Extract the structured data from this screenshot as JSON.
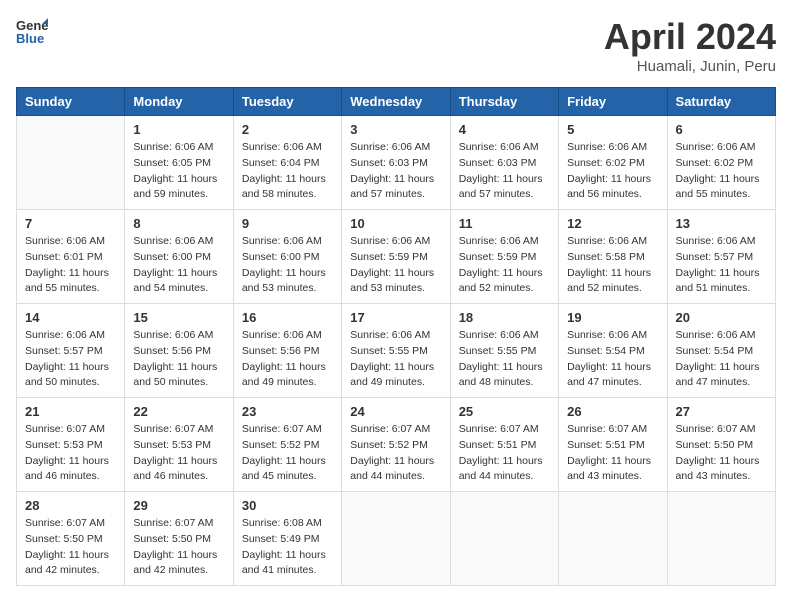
{
  "header": {
    "logo_line1": "General",
    "logo_line2": "Blue",
    "title": "April 2024",
    "subtitle": "Huamali, Junin, Peru"
  },
  "weekdays": [
    "Sunday",
    "Monday",
    "Tuesday",
    "Wednesday",
    "Thursday",
    "Friday",
    "Saturday"
  ],
  "weeks": [
    [
      {
        "day": "",
        "info": ""
      },
      {
        "day": "1",
        "info": "Sunrise: 6:06 AM\nSunset: 6:05 PM\nDaylight: 11 hours\nand 59 minutes."
      },
      {
        "day": "2",
        "info": "Sunrise: 6:06 AM\nSunset: 6:04 PM\nDaylight: 11 hours\nand 58 minutes."
      },
      {
        "day": "3",
        "info": "Sunrise: 6:06 AM\nSunset: 6:03 PM\nDaylight: 11 hours\nand 57 minutes."
      },
      {
        "day": "4",
        "info": "Sunrise: 6:06 AM\nSunset: 6:03 PM\nDaylight: 11 hours\nand 57 minutes."
      },
      {
        "day": "5",
        "info": "Sunrise: 6:06 AM\nSunset: 6:02 PM\nDaylight: 11 hours\nand 56 minutes."
      },
      {
        "day": "6",
        "info": "Sunrise: 6:06 AM\nSunset: 6:02 PM\nDaylight: 11 hours\nand 55 minutes."
      }
    ],
    [
      {
        "day": "7",
        "info": "Sunrise: 6:06 AM\nSunset: 6:01 PM\nDaylight: 11 hours\nand 55 minutes."
      },
      {
        "day": "8",
        "info": "Sunrise: 6:06 AM\nSunset: 6:00 PM\nDaylight: 11 hours\nand 54 minutes."
      },
      {
        "day": "9",
        "info": "Sunrise: 6:06 AM\nSunset: 6:00 PM\nDaylight: 11 hours\nand 53 minutes."
      },
      {
        "day": "10",
        "info": "Sunrise: 6:06 AM\nSunset: 5:59 PM\nDaylight: 11 hours\nand 53 minutes."
      },
      {
        "day": "11",
        "info": "Sunrise: 6:06 AM\nSunset: 5:59 PM\nDaylight: 11 hours\nand 52 minutes."
      },
      {
        "day": "12",
        "info": "Sunrise: 6:06 AM\nSunset: 5:58 PM\nDaylight: 11 hours\nand 52 minutes."
      },
      {
        "day": "13",
        "info": "Sunrise: 6:06 AM\nSunset: 5:57 PM\nDaylight: 11 hours\nand 51 minutes."
      }
    ],
    [
      {
        "day": "14",
        "info": "Sunrise: 6:06 AM\nSunset: 5:57 PM\nDaylight: 11 hours\nand 50 minutes."
      },
      {
        "day": "15",
        "info": "Sunrise: 6:06 AM\nSunset: 5:56 PM\nDaylight: 11 hours\nand 50 minutes."
      },
      {
        "day": "16",
        "info": "Sunrise: 6:06 AM\nSunset: 5:56 PM\nDaylight: 11 hours\nand 49 minutes."
      },
      {
        "day": "17",
        "info": "Sunrise: 6:06 AM\nSunset: 5:55 PM\nDaylight: 11 hours\nand 49 minutes."
      },
      {
        "day": "18",
        "info": "Sunrise: 6:06 AM\nSunset: 5:55 PM\nDaylight: 11 hours\nand 48 minutes."
      },
      {
        "day": "19",
        "info": "Sunrise: 6:06 AM\nSunset: 5:54 PM\nDaylight: 11 hours\nand 47 minutes."
      },
      {
        "day": "20",
        "info": "Sunrise: 6:06 AM\nSunset: 5:54 PM\nDaylight: 11 hours\nand 47 minutes."
      }
    ],
    [
      {
        "day": "21",
        "info": "Sunrise: 6:07 AM\nSunset: 5:53 PM\nDaylight: 11 hours\nand 46 minutes."
      },
      {
        "day": "22",
        "info": "Sunrise: 6:07 AM\nSunset: 5:53 PM\nDaylight: 11 hours\nand 46 minutes."
      },
      {
        "day": "23",
        "info": "Sunrise: 6:07 AM\nSunset: 5:52 PM\nDaylight: 11 hours\nand 45 minutes."
      },
      {
        "day": "24",
        "info": "Sunrise: 6:07 AM\nSunset: 5:52 PM\nDaylight: 11 hours\nand 44 minutes."
      },
      {
        "day": "25",
        "info": "Sunrise: 6:07 AM\nSunset: 5:51 PM\nDaylight: 11 hours\nand 44 minutes."
      },
      {
        "day": "26",
        "info": "Sunrise: 6:07 AM\nSunset: 5:51 PM\nDaylight: 11 hours\nand 43 minutes."
      },
      {
        "day": "27",
        "info": "Sunrise: 6:07 AM\nSunset: 5:50 PM\nDaylight: 11 hours\nand 43 minutes."
      }
    ],
    [
      {
        "day": "28",
        "info": "Sunrise: 6:07 AM\nSunset: 5:50 PM\nDaylight: 11 hours\nand 42 minutes."
      },
      {
        "day": "29",
        "info": "Sunrise: 6:07 AM\nSunset: 5:50 PM\nDaylight: 11 hours\nand 42 minutes."
      },
      {
        "day": "30",
        "info": "Sunrise: 6:08 AM\nSunset: 5:49 PM\nDaylight: 11 hours\nand 41 minutes."
      },
      {
        "day": "",
        "info": ""
      },
      {
        "day": "",
        "info": ""
      },
      {
        "day": "",
        "info": ""
      },
      {
        "day": "",
        "info": ""
      }
    ]
  ]
}
